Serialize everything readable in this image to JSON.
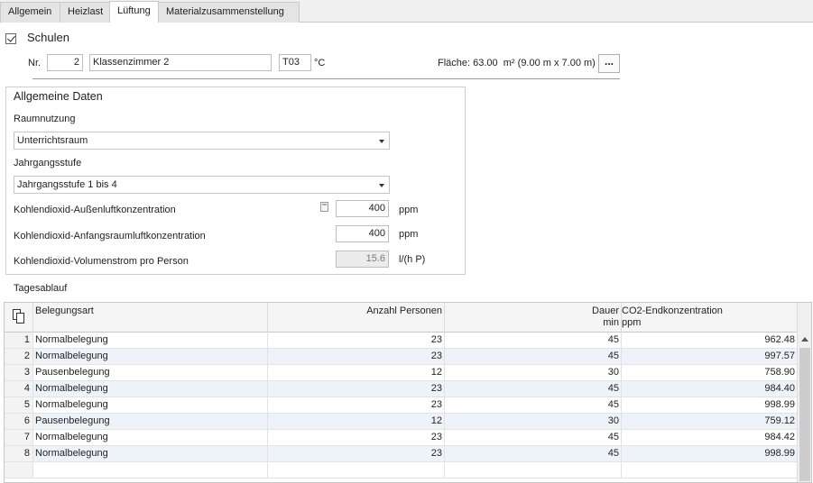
{
  "tabs": [
    {
      "label": "Allgemein",
      "active": false
    },
    {
      "label": "Heizlast",
      "active": false
    },
    {
      "label": "Lüftung",
      "active": true
    },
    {
      "label": "Materialzusammenstellung",
      "active": false
    }
  ],
  "schulen": {
    "label": "Schulen",
    "checked": true
  },
  "room": {
    "nr_label": "Nr.",
    "nr": "2",
    "name": "Klassenzimmer 2",
    "temp_code": "T03",
    "temp_unit": "°C",
    "area_text": "Fläche: 63.00  m² (9.00 m x 7.00 m)",
    "more_button": "..."
  },
  "general": {
    "title": "Allgemeine Daten",
    "raumnutzung_label": "Raumnutzung",
    "raumnutzung_value": "Unterrichtsraum",
    "jahrgang_label": "Jahrgangsstufe",
    "jahrgang_value": "Jahrgangsstufe 1 bis 4",
    "outdoor_label": "Kohlendioxid-Außenluftkonzentration",
    "outdoor_value": "400",
    "outdoor_unit": "ppm",
    "initial_label": "Kohlendioxid-Anfangsraumluftkonzentration",
    "initial_value": "400",
    "initial_unit": "ppm",
    "flow_label": "Kohlendioxid-Volumenstrom pro Person",
    "flow_value": "15.6",
    "flow_unit": "l/(h P)"
  },
  "schedule": {
    "title": "Tagesablauf",
    "columns": {
      "type": "Belegungsart",
      "persons": "Anzahl Personen",
      "duration": "Dauer",
      "duration_unit": "min",
      "co2": "CO2-Endkonzentration",
      "co2_unit": "ppm"
    },
    "rows": [
      {
        "n": "1",
        "type": "Normalbelegung",
        "persons": "23",
        "duration": "45",
        "co2": "962.48"
      },
      {
        "n": "2",
        "type": "Normalbelegung",
        "persons": "23",
        "duration": "45",
        "co2": "997.57"
      },
      {
        "n": "3",
        "type": "Pausenbelegung",
        "persons": "12",
        "duration": "30",
        "co2": "758.90"
      },
      {
        "n": "4",
        "type": "Normalbelegung",
        "persons": "23",
        "duration": "45",
        "co2": "984.40"
      },
      {
        "n": "5",
        "type": "Normalbelegung",
        "persons": "23",
        "duration": "45",
        "co2": "998.99"
      },
      {
        "n": "6",
        "type": "Pausenbelegung",
        "persons": "12",
        "duration": "30",
        "co2": "759.12"
      },
      {
        "n": "7",
        "type": "Normalbelegung",
        "persons": "23",
        "duration": "45",
        "co2": "984.42"
      },
      {
        "n": "8",
        "type": "Normalbelegung",
        "persons": "23",
        "duration": "45",
        "co2": "998.99"
      }
    ]
  }
}
